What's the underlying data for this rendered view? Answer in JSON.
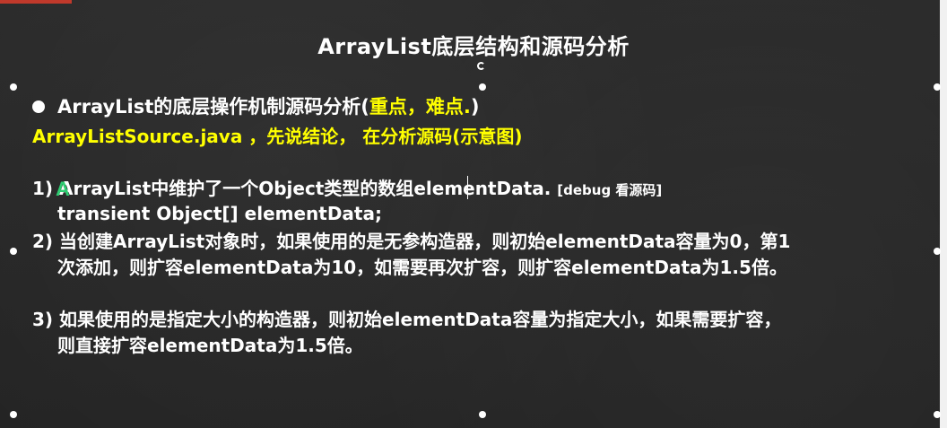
{
  "slide": {
    "title": "ArrayList底层结构和源码分析",
    "bullet": {
      "main_text": "ArrayList的底层操作机制源码分析(",
      "highlight": "重点，难点.",
      "close": ")"
    },
    "subtitle": "ArrayListSource.java ，先说结论， 在分析源码(示意图)",
    "points": {
      "p1_line1_a": "1) ArrayList中维护了一个Object类型的数组elementData.",
      "p1_note": "[debug 看源码]",
      "p1_line2": "transient Object[] elementData;",
      "p2_line1": "2) 当创建ArrayList对象时，如果使用的是无参构造器，则初始elementData容量为0，第1",
      "p2_line2": "次添加，则扩容elementData为10，如需要再次扩容，则扩容elementData为1.5倍。",
      "p3_line1": "3) 如果使用的是指定大小的构造器，则初始elementData容量为指定大小，如果需要扩容，",
      "p3_line2": "则直接扩容elementData为1.5倍。"
    },
    "colors": {
      "background": "#272727",
      "text": "#ffffff",
      "highlight": "#ffff00",
      "cursor": "#2ecc71"
    }
  }
}
